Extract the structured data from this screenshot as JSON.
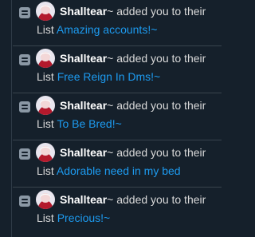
{
  "notifications": [
    {
      "name": "Shalltear",
      "action": "~ added you to their",
      "list_word": "List",
      "list_name": "Amazing accounts!~"
    },
    {
      "name": "Shalltear",
      "action": "~ added you to their",
      "list_word": "List",
      "list_name": "Free Reign In Dms!~"
    },
    {
      "name": "Shalltear",
      "action": "~ added you to their",
      "list_word": "List",
      "list_name": "To Be Bred!~"
    },
    {
      "name": "Shalltear",
      "action": "~ added you to their",
      "list_word": "List",
      "list_name": "Adorable need in my bed"
    },
    {
      "name": "Shalltear",
      "action": "~ added you to their",
      "list_word": "List",
      "list_name": "Precious!~"
    }
  ],
  "icon": "list-icon",
  "colors": {
    "background": "#15202b",
    "link": "#1d9bf0",
    "divider": "#38444d"
  }
}
